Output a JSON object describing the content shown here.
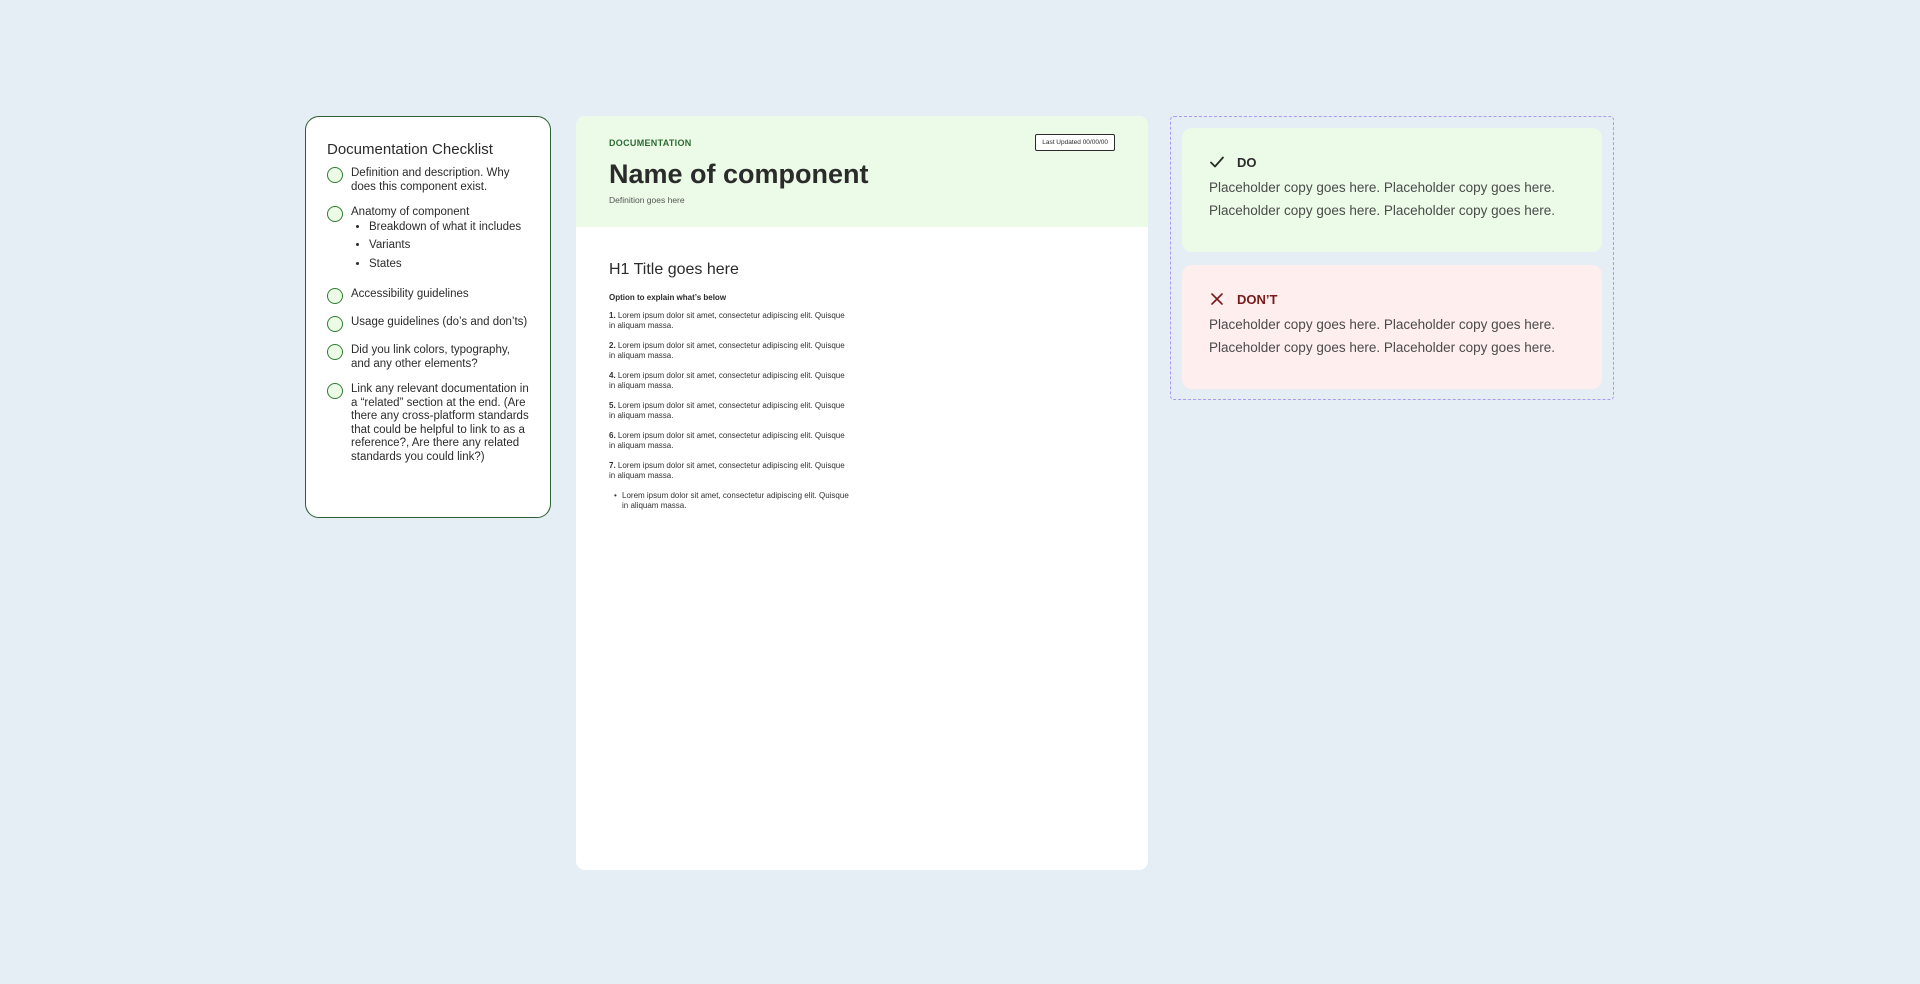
{
  "checklist": {
    "title": "Documentation Checklist",
    "items": [
      {
        "text": "Definition and description. Why does this component exist."
      },
      {
        "text": "Anatomy of component",
        "subitems": [
          "Breakdown of what it includes",
          "Variants",
          "States"
        ]
      },
      {
        "text": "Accessibility guidelines"
      },
      {
        "text": "Usage guidelines (do’s and don’ts)"
      },
      {
        "text": "Did you link colors, typography, and any other elements?"
      },
      {
        "text": "Link any relevant documentation in a “related” section at the end. (Are there any cross-platform standards that could be helpful to link to as a reference?, Are there any related standards you could link?)"
      }
    ]
  },
  "doc": {
    "eyebrow": "DOCUMENTATION",
    "last_updated": "Last Updated 00/00/00",
    "title": "Name of component",
    "definition": "Definition goes here",
    "h1": "H1 Title goes here",
    "option": "Option to explain what’s below",
    "items": [
      {
        "num": "1.",
        "text": "Lorem ipsum dolor sit amet, consectetur adipiscing elit. Quisque in aliquam massa."
      },
      {
        "num": "2.",
        "text": "Lorem ipsum dolor sit amet, consectetur adipiscing elit. Quisque in aliquam massa."
      },
      {
        "num": "4.",
        "text": "Lorem ipsum dolor sit amet, consectetur adipiscing elit. Quisque in aliquam massa."
      },
      {
        "num": "5.",
        "text": "Lorem ipsum dolor sit amet, consectetur adipiscing elit. Quisque in aliquam massa."
      },
      {
        "num": "6.",
        "text": "Lorem ipsum dolor sit amet, consectetur adipiscing elit. Quisque in aliquam massa."
      },
      {
        "num": "7.",
        "text": "Lorem ipsum dolor sit amet, consectetur adipiscing elit. Quisque in aliquam massa."
      }
    ],
    "bullet": "Lorem ipsum dolor sit amet, consectetur adipiscing elit. Quisque in aliquam massa."
  },
  "do": {
    "label": "DO",
    "icon": "check-icon",
    "copy": "Placeholder copy goes here. Placeholder copy goes here. Placeholder copy goes here. Placeholder copy goes here."
  },
  "dont": {
    "label": "DON’T",
    "icon": "x-icon",
    "copy": "Placeholder copy goes here. Placeholder copy goes here. Placeholder copy goes here. Placeholder copy goes here."
  },
  "colors": {
    "background": "#e5edf5",
    "accent_green": "#2e6b33",
    "do_bg": "#ecfbe8",
    "dont_bg": "#feeeee",
    "dont_text": "#7a1a1a",
    "dashed_border": "#a79af0"
  }
}
